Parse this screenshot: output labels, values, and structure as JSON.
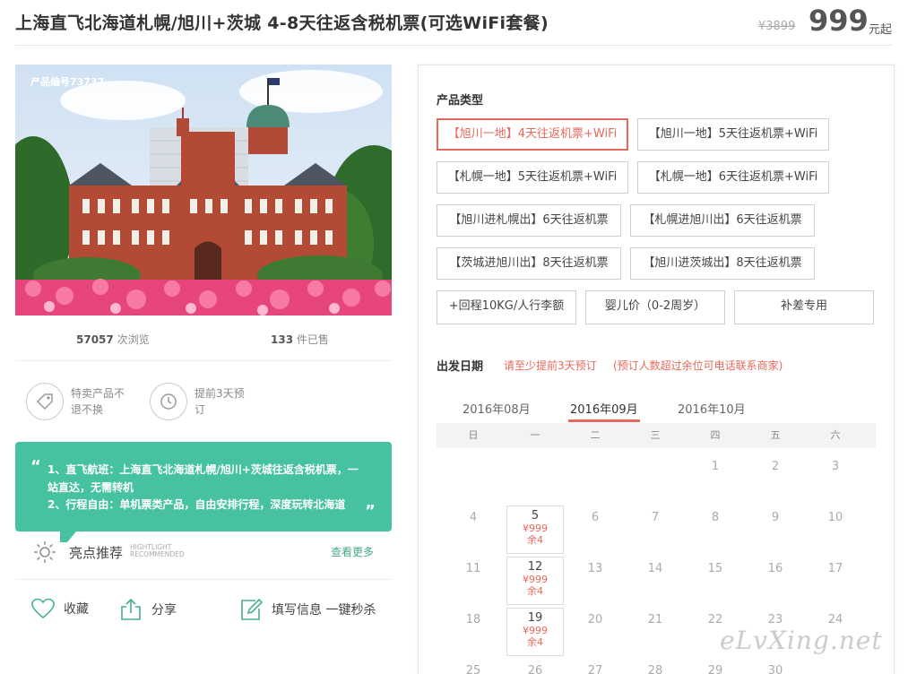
{
  "header": {
    "title": "上海直飞北海道札幌/旭川+茨城 4-8天往返含税机票(可选WiFi套餐)",
    "price_old": "¥3899",
    "price_now": "999",
    "price_unit": "元起"
  },
  "left": {
    "product_id": "产品编号73737",
    "views_count": "57057",
    "views_label": "次浏览",
    "sold_count": "133",
    "sold_label": "件已售",
    "features": [
      {
        "label": "特卖产品不退不换",
        "icon": "tag-icon"
      },
      {
        "label": "提前3天预订",
        "icon": "clock-icon"
      }
    ],
    "highlights": {
      "line1": "1、直飞航班：上海直飞北海道札幌/旭川+茨城往返含税机票，一站直达，无需转机",
      "line2": "2、行程自由：单机票类产品，自由安排行程，深度玩转北海道",
      "title": "亮点推荐",
      "title_en1": "HIGHTLIGHT",
      "title_en2": "RECOMMENDED",
      "more": "查看更多"
    },
    "actions": {
      "favorite": "收藏",
      "share": "分享",
      "fill": "填写信息 一键秒杀"
    }
  },
  "panel": {
    "type_title": "产品类型",
    "options": [
      "【旭川一地】4天往返机票+WiFi",
      "【旭川一地】5天往返机票+WiFi",
      "【札幌一地】5天往返机票+WiFi",
      "【札幌一地】6天往返机票+WiFi",
      "【旭川进札幌出】6天往返机票",
      "【札幌进旭川出】6天往返机票",
      "【茨城进旭川出】8天往返机票",
      "【旭川进茨城出】8天往返机票",
      "+回程10KG/人行李额",
      "婴儿价（0-2周岁）",
      "补差专用"
    ],
    "selected_option": 0,
    "date_title": "出发日期",
    "note1": "请至少提前3天预订",
    "note2": "(预订人数超过余位可电话联系商家)",
    "months": [
      "2016年08月",
      "2016年09月",
      "2016年10月"
    ],
    "active_month": 1,
    "weekdays": [
      "日",
      "一",
      "二",
      "三",
      "四",
      "五",
      "六"
    ],
    "calendar_rows": [
      [
        "",
        "",
        "",
        "",
        "1",
        "2",
        "3"
      ],
      [
        "4",
        "5",
        "6",
        "7",
        "8",
        "9",
        "10"
      ],
      [
        "11",
        "12",
        "13",
        "14",
        "15",
        "16",
        "17"
      ],
      [
        "18",
        "19",
        "20",
        "21",
        "22",
        "23",
        "24"
      ],
      [
        "25",
        "26",
        "27",
        "28",
        "29",
        "30",
        ""
      ]
    ],
    "available": {
      "5": {
        "price": "¥999",
        "stock": "余4"
      },
      "12": {
        "price": "¥999",
        "stock": "余4"
      },
      "19": {
        "price": "¥999",
        "stock": "余4"
      }
    }
  },
  "watermark": "eLvXing.net",
  "colors": {
    "accent": "#e9685c",
    "green": "#46c2a0"
  }
}
